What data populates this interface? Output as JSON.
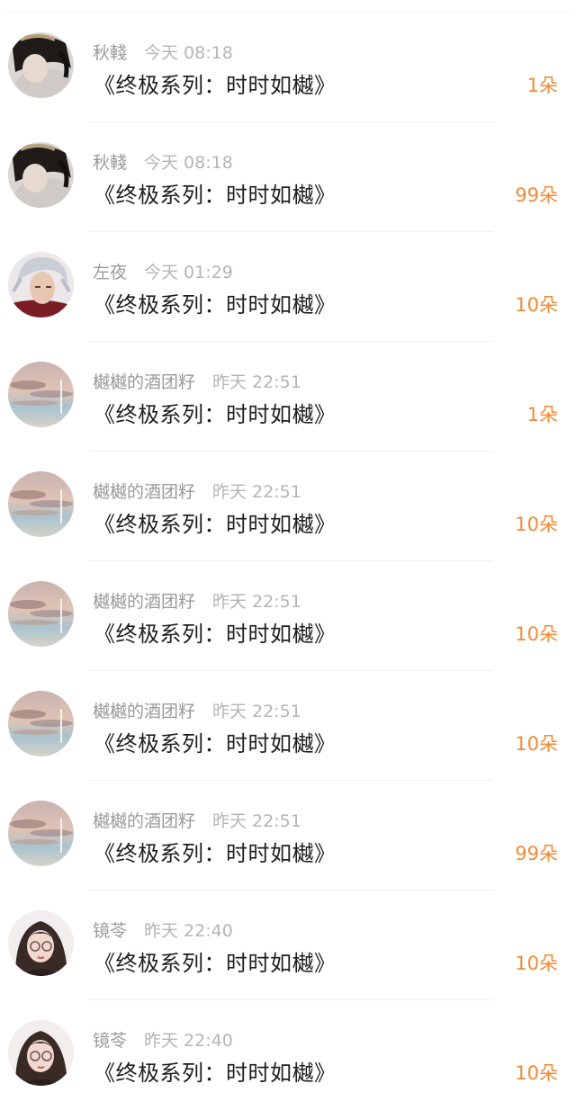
{
  "colors": {
    "count": "#f08a37",
    "name": "#9a9a9a",
    "time": "#b5b5b5",
    "title": "#1f1f1f"
  },
  "records": [
    {
      "name": "秋輚",
      "time": "今天 08:18",
      "gift": "《终极系列：时时如樾》",
      "count": "1朵",
      "avatar": "avatar-dark-hair"
    },
    {
      "name": "秋輚",
      "time": "今天 08:18",
      "gift": "《终极系列：时时如樾》",
      "count": "99朵",
      "avatar": "avatar-dark-hair"
    },
    {
      "name": "左夜",
      "time": "今天 01:29",
      "gift": "《终极系列：时时如樾》",
      "count": "10朵",
      "avatar": "avatar-anime-silver"
    },
    {
      "name": "樾樾的酒团籽",
      "time": "昨天 22:51",
      "gift": "《终极系列：时时如樾》",
      "count": "1朵",
      "avatar": "avatar-sky"
    },
    {
      "name": "樾樾的酒团籽",
      "time": "昨天 22:51",
      "gift": "《终极系列：时时如樾》",
      "count": "10朵",
      "avatar": "avatar-sky"
    },
    {
      "name": "樾樾的酒团籽",
      "time": "昨天 22:51",
      "gift": "《终极系列：时时如樾》",
      "count": "10朵",
      "avatar": "avatar-sky"
    },
    {
      "name": "樾樾的酒团籽",
      "time": "昨天 22:51",
      "gift": "《终极系列：时时如樾》",
      "count": "10朵",
      "avatar": "avatar-sky"
    },
    {
      "name": "樾樾的酒团籽",
      "time": "昨天 22:51",
      "gift": "《终极系列：时时如樾》",
      "count": "99朵",
      "avatar": "avatar-sky"
    },
    {
      "name": "镜苓",
      "time": "昨天 22:40",
      "gift": "《终极系列：时时如樾》",
      "count": "10朵",
      "avatar": "avatar-girl-glasses"
    },
    {
      "name": "镜苓",
      "time": "昨天 22:40",
      "gift": "《终极系列：时时如樾》",
      "count": "10朵",
      "avatar": "avatar-girl-glasses"
    }
  ]
}
